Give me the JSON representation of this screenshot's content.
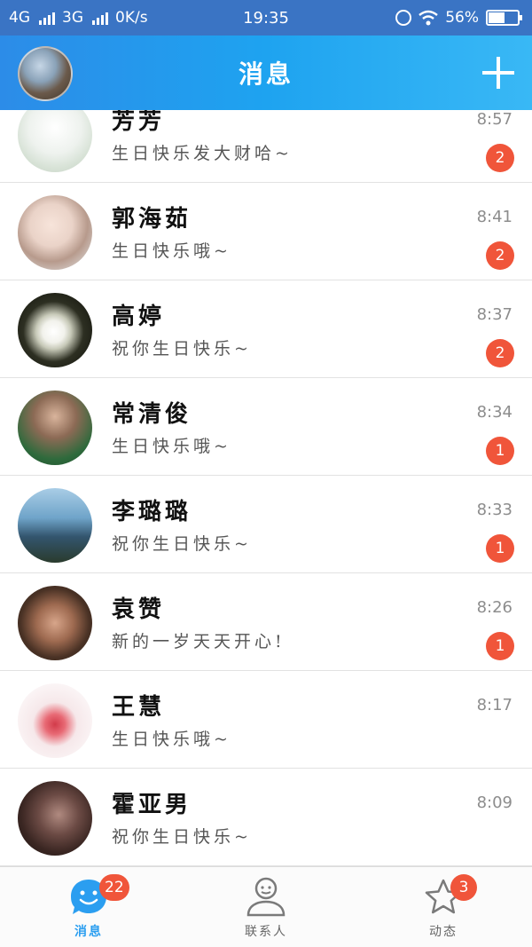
{
  "status_bar": {
    "network_left": "4G",
    "network_right": "3G",
    "speed": "0K/s",
    "time": "19:35",
    "battery_text": "56%",
    "battery_level": 0.56
  },
  "header": {
    "title": "消息",
    "add_icon": "plus-icon"
  },
  "conversations": [
    {
      "name": "芳芳",
      "message": "生日快乐发大财哈~",
      "time": "8:57",
      "unread": "2"
    },
    {
      "name": "郭海茹",
      "message": "生日快乐哦~",
      "time": "8:41",
      "unread": "2"
    },
    {
      "name": "高婷",
      "message": "祝你生日快乐~",
      "time": "8:37",
      "unread": "2"
    },
    {
      "name": "常清俊",
      "message": "生日快乐哦~",
      "time": "8:34",
      "unread": "1"
    },
    {
      "name": "李璐璐",
      "message": "祝你生日快乐~",
      "time": "8:33",
      "unread": "1"
    },
    {
      "name": "袁赞",
      "message": "新的一岁天天开心!",
      "time": "8:26",
      "unread": "1"
    },
    {
      "name": "王慧",
      "message": "生日快乐哦~",
      "time": "8:17",
      "unread": ""
    },
    {
      "name": "霍亚男",
      "message": "祝你生日快乐~",
      "time": "8:09",
      "unread": ""
    }
  ],
  "bottom_nav": {
    "tabs": [
      {
        "label": "消息",
        "badge": "22",
        "icon": "chat-bubble-icon"
      },
      {
        "label": "联系人",
        "badge": "",
        "icon": "contact-person-icon"
      },
      {
        "label": "动态",
        "badge": "3",
        "icon": "star-icon"
      }
    ]
  },
  "colors": {
    "header_start": "#2c8ce8",
    "header_end": "#39b8f5",
    "badge": "#f0553a",
    "active_tab": "#2b9ef0"
  }
}
